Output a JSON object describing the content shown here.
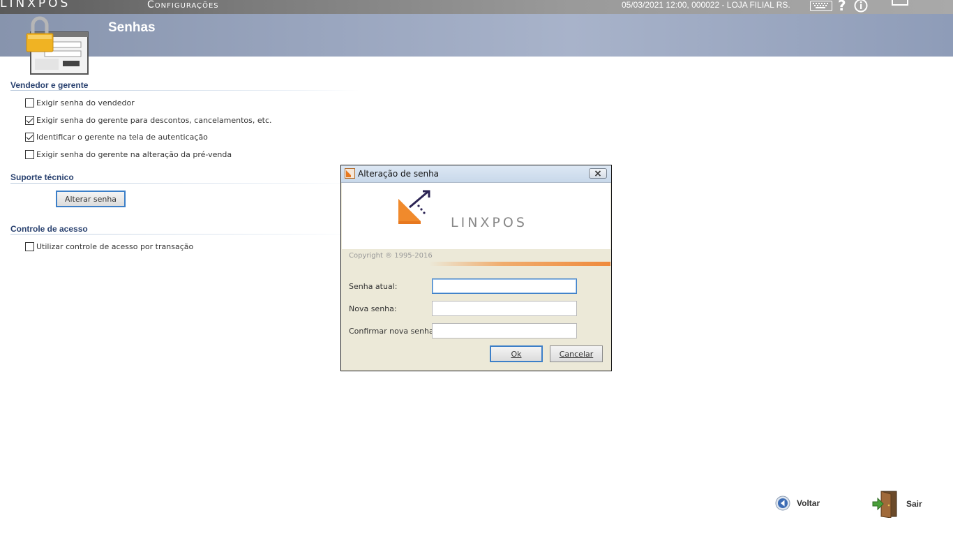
{
  "topbar": {
    "brand": "LINXPOS",
    "module": "Configurações",
    "session": "05/03/2021 12:00, 000022 - LOJA FILIAL RS.",
    "icons": [
      "keyboard-icon",
      "help-icon",
      "info-icon",
      "screen-icon"
    ]
  },
  "header": {
    "title": "Senhas",
    "icon": "lock-icon"
  },
  "sections": {
    "vendedor": {
      "title": "Vendedor e gerente",
      "options": [
        {
          "label": "Exigir senha do vendedor",
          "checked": false
        },
        {
          "label": "Exigir senha do gerente para descontos, cancelamentos, etc.",
          "checked": true
        },
        {
          "label": "Identificar o gerente na tela de autenticação",
          "checked": true
        },
        {
          "label": "Exigir senha do gerente na alteração da pré-venda",
          "checked": false
        }
      ]
    },
    "suporte": {
      "title": "Suporte técnico",
      "button": "Alterar senha"
    },
    "controle": {
      "title": "Controle de acesso",
      "options": [
        {
          "label": "Utilizar controle de acesso por transação",
          "checked": false
        }
      ]
    }
  },
  "nav": {
    "back": "Voltar",
    "exit": "Sair"
  },
  "dialog": {
    "title": "Alteração de senha",
    "brand": "LINXPOS",
    "copyright": "Copyright ® 1995-2016",
    "fields": {
      "current_label": "Senha atual:",
      "current_value": "",
      "new_label": "Nova senha:",
      "new_value": "",
      "confirm_label": "Confirmar nova senha:",
      "confirm_value": ""
    },
    "ok": "Ok",
    "cancel": "Cancelar"
  },
  "colors": {
    "header_band": "#9aa6bf",
    "section_title": "#2a4270",
    "focus_blue": "#3c7fc8",
    "accent_orange": "#ef8a3c"
  }
}
